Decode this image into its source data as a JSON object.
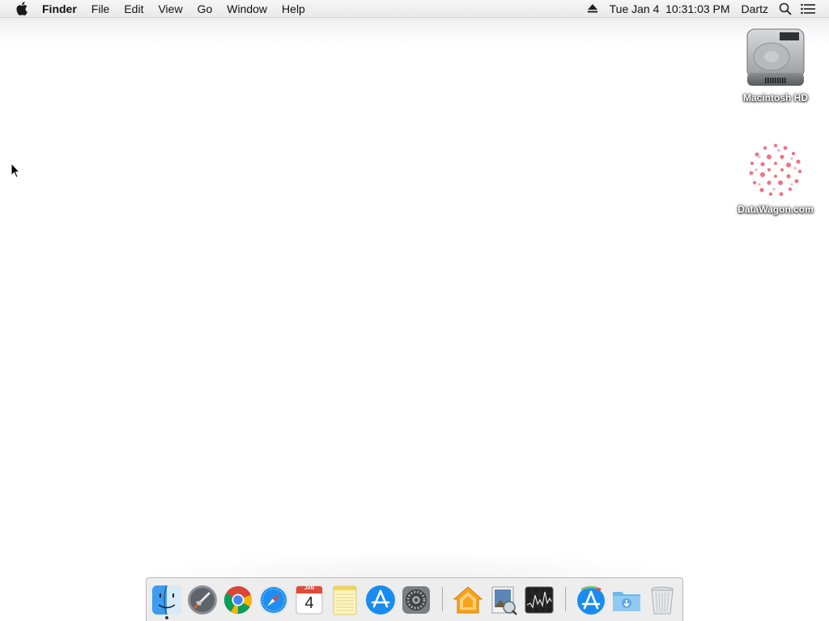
{
  "menubar": {
    "app_name": "Finder",
    "menus": [
      "File",
      "Edit",
      "View",
      "Go",
      "Window",
      "Help"
    ],
    "clock": "Tue Jan 4  10:31:03 PM",
    "user": "Dartz",
    "icons": [
      "apple-icon",
      "eject-icon",
      "spotlight-search-icon",
      "notification-center-icon"
    ]
  },
  "desktop": {
    "icons": [
      {
        "label": "Macintosh HD",
        "icon": "hard-drive-icon"
      },
      {
        "label": "DataWagon.com",
        "icon": "disk-image-icon"
      }
    ]
  },
  "dock": {
    "items": [
      {
        "name": "Finder",
        "icon": "finder-icon",
        "running": true
      },
      {
        "name": "Launchpad",
        "icon": "launchpad-icon"
      },
      {
        "name": "Google Chrome",
        "icon": "chrome-icon"
      },
      {
        "name": "Safari",
        "icon": "safari-icon"
      },
      {
        "name": "Calendar",
        "icon": "calendar-icon",
        "badge_month": "JAN",
        "badge_day": "4"
      },
      {
        "name": "Notes",
        "icon": "notes-icon"
      },
      {
        "name": "App Store",
        "icon": "app-store-icon"
      },
      {
        "name": "System Preferences",
        "icon": "system-preferences-icon"
      },
      {
        "name": "Home",
        "icon": "home-icon"
      },
      {
        "name": "Preview",
        "icon": "preview-icon"
      },
      {
        "name": "Activity Monitor",
        "icon": "activity-monitor-icon"
      },
      {
        "name": "Applications",
        "icon": "applications-folder-icon"
      },
      {
        "name": "Downloads",
        "icon": "downloads-folder-icon"
      },
      {
        "name": "Trash",
        "icon": "trash-icon"
      }
    ]
  },
  "colors": {
    "menubar_bg": "#eeeeee",
    "desktop_bg": "#ffffff",
    "dock_bg": "#ececec",
    "app_store_blue": "#1a8cf0"
  }
}
